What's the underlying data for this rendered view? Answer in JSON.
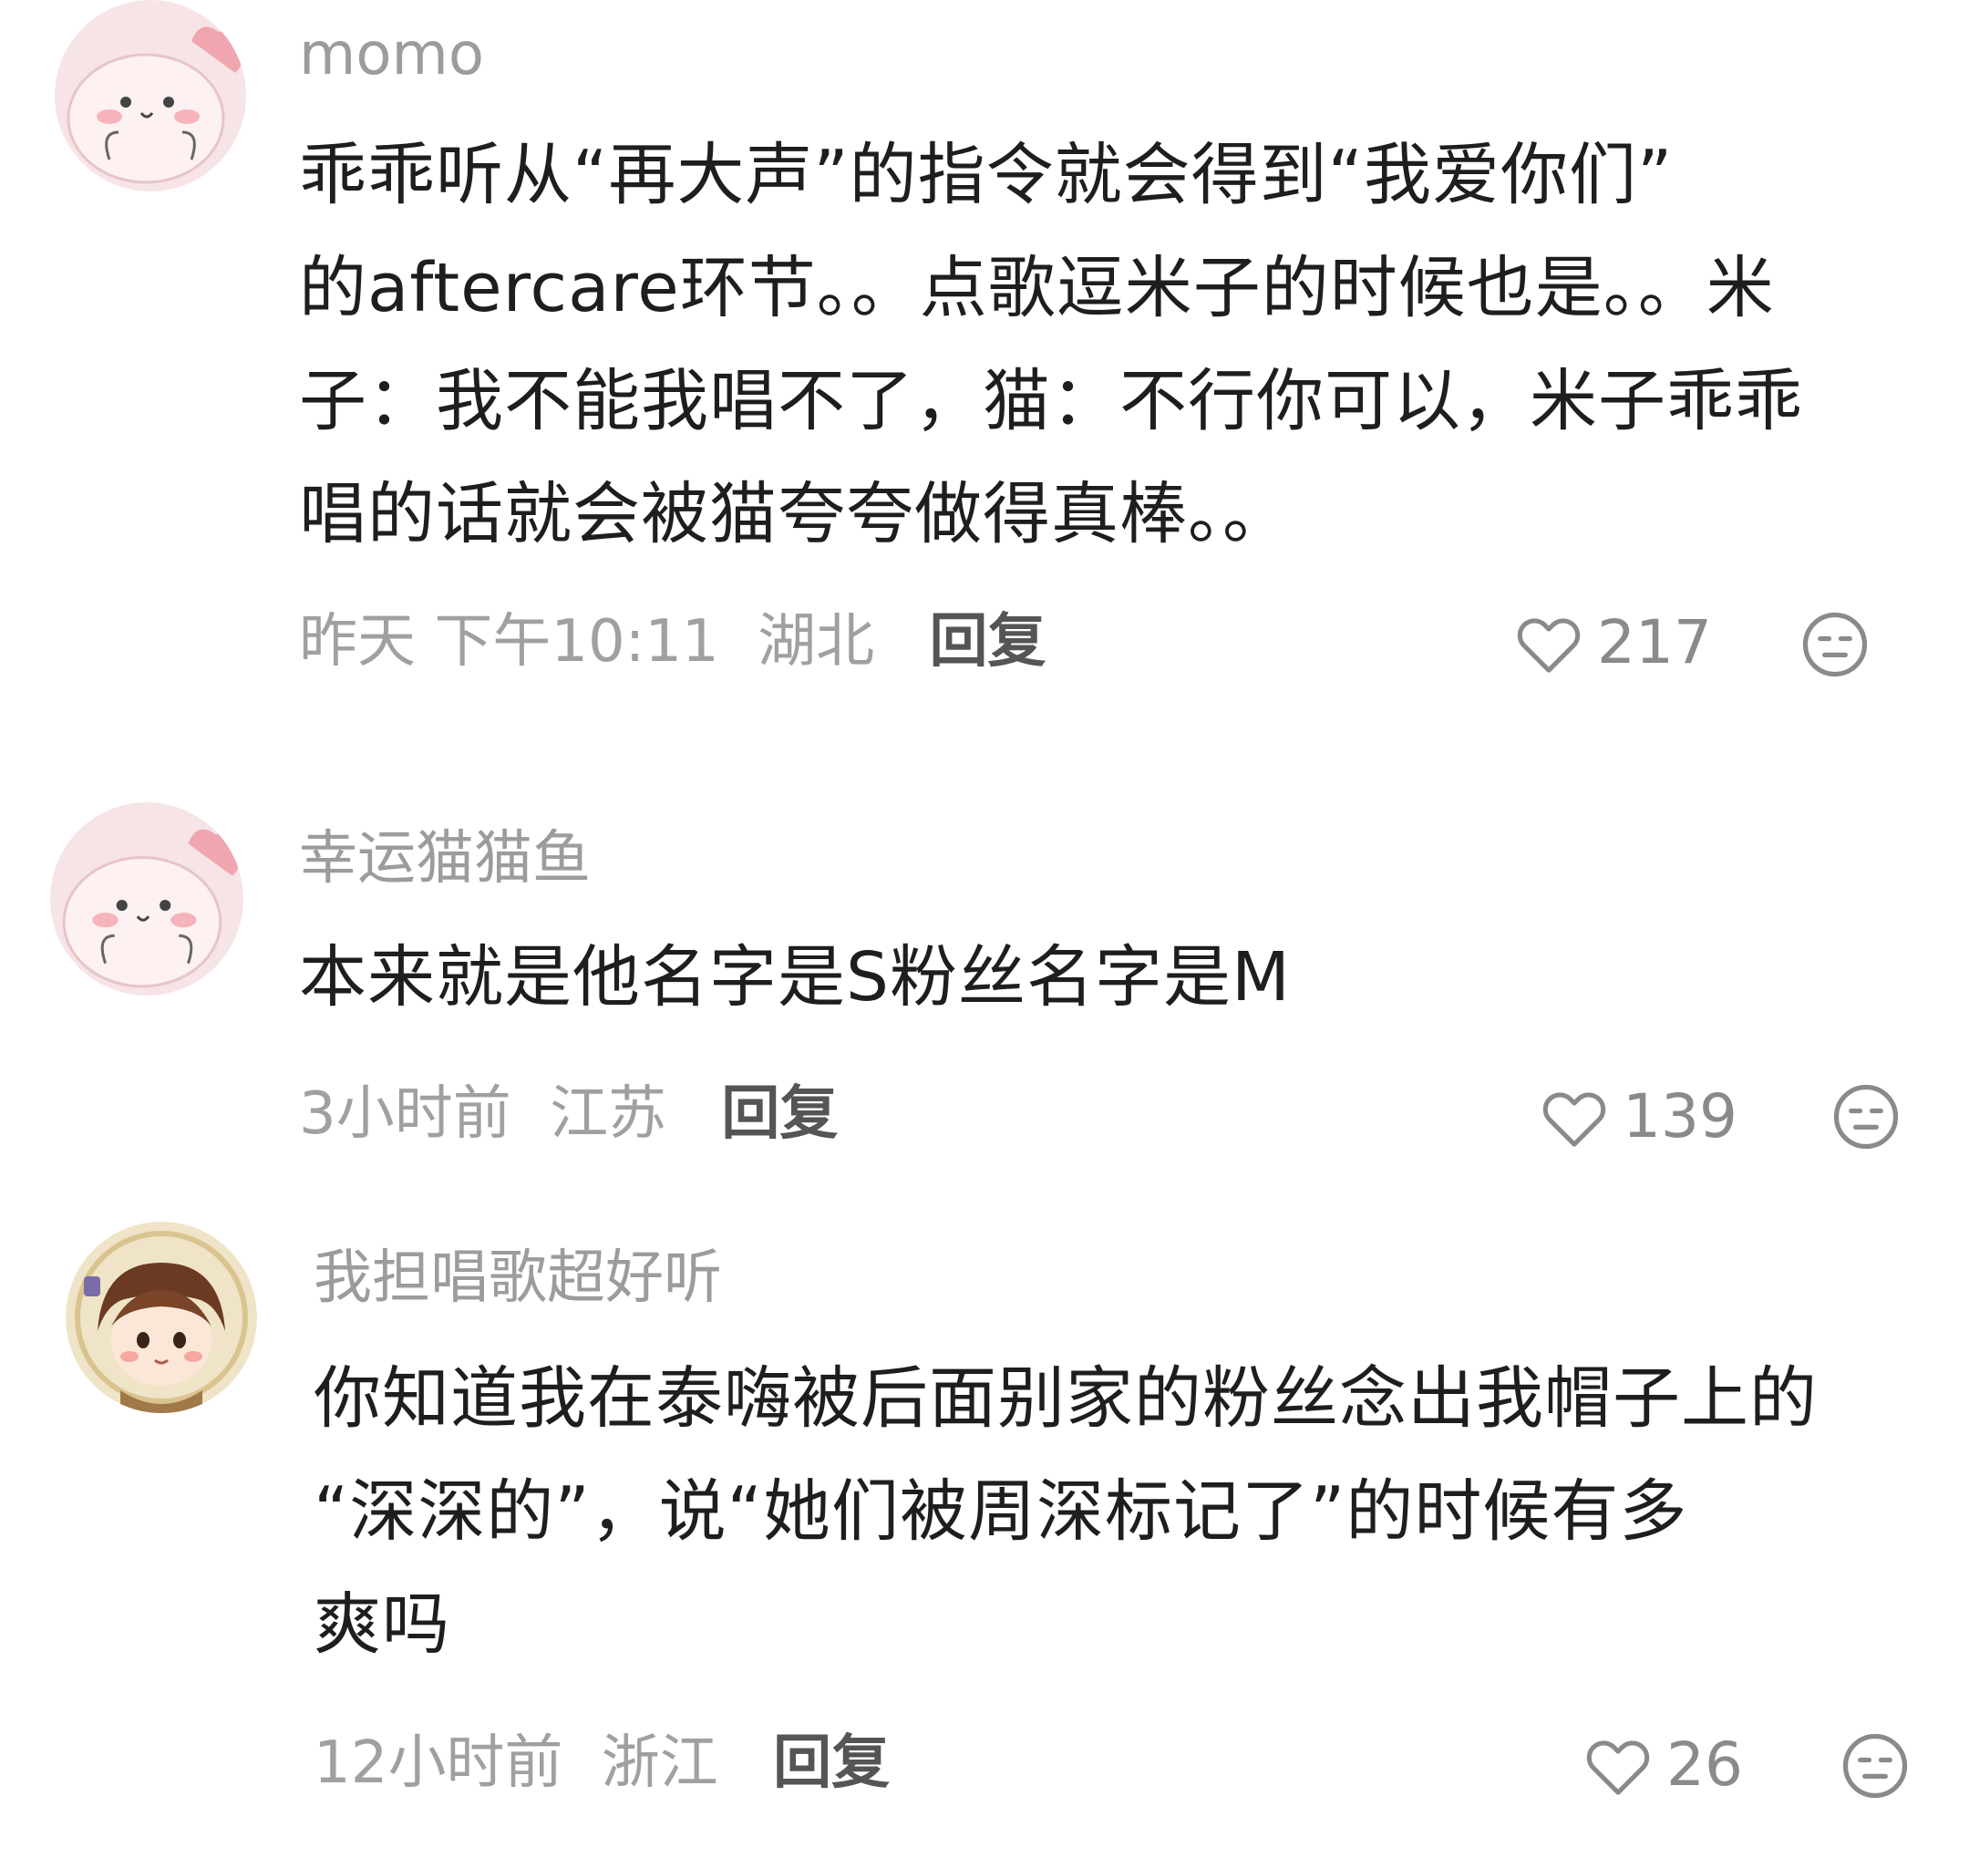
{
  "comments": [
    {
      "username": "momo",
      "lines": [
        "乖乖听从“再大声”的指令就会得到“我爱你们”",
        "的aftercare环节。。点歌逗米子的时候也是。。米",
        "子：我不能我唱不了，猫：不行你可以，米子乖乖",
        "唱的话就会被猫夸夸做得真棒。。"
      ],
      "time": "昨天 下午10:11",
      "location": "湖北",
      "reply": "回复",
      "likes": "217",
      "avatar_icon": "pink-cartoon-avatar-icon"
    },
    {
      "username": "幸运猫猫鱼",
      "lines": [
        "本来就是他名字是S粉丝名字是M"
      ],
      "time": "3小时前",
      "location": "江苏",
      "reply": "回复",
      "likes": "139",
      "avatar_icon": "pink-cartoon-avatar-icon"
    },
    {
      "username": "我担唱歌超好听",
      "lines": [
        "你知道我在泰嗨被后面别家的粉丝念出我帽子上的",
        "“深深的”，说“她们被周深标记了”的时候有多",
        "爽吗"
      ],
      "time": "12小时前",
      "location": "浙江",
      "reply": "回复",
      "likes": "26",
      "avatar_icon": "anime-boy-avatar-icon"
    }
  ],
  "colors": {
    "username": "#9c9c9c",
    "content": "#1e1e1e",
    "meta": "#a0a0a0",
    "reply": "#555555",
    "icon": "#8a8a8a"
  }
}
